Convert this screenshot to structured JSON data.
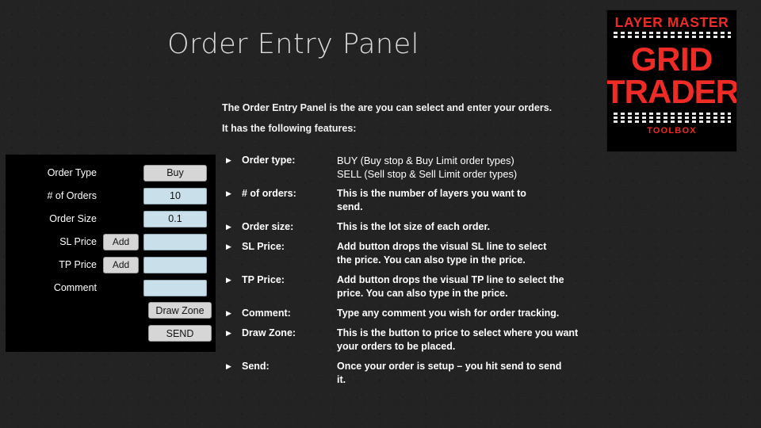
{
  "page": {
    "title": "Order Entry Panel",
    "background_color": "#232323"
  },
  "logo": {
    "top_text": "LAYER MASTER",
    "main_line1": "GRID",
    "main_line2": "TRADER",
    "bottom_text": "TOOLBOX",
    "accent_color": "#ee2b24",
    "background_color": "#000000"
  },
  "intro": {
    "line1": "The Order Entry Panel is the are you can select and enter your orders.",
    "line2": "It has the following features:"
  },
  "order_panel": {
    "rows": [
      {
        "label": "Order Type",
        "add_button": null,
        "value": "Buy",
        "style": "gray"
      },
      {
        "label": "# of Orders",
        "add_button": null,
        "value": "10",
        "style": "blue"
      },
      {
        "label": "Order Size",
        "add_button": null,
        "value": "0.1",
        "style": "blue"
      },
      {
        "label": "SL Price",
        "add_button": "Add",
        "value": "",
        "style": "blue"
      },
      {
        "label": "TP Price",
        "add_button": "Add",
        "value": "",
        "style": "blue"
      },
      {
        "label": "Comment",
        "add_button": null,
        "value": "",
        "style": "blue"
      }
    ],
    "draw_zone_button": "Draw Zone",
    "send_button": "SEND",
    "field_color": "#c9dfe9",
    "button_color": "#d6d6d6"
  },
  "features": {
    "bullet_glyph": "▶",
    "items": [
      {
        "label": "Order type:",
        "desc_lines": [
          "BUY (Buy stop & Buy Limit order types)",
          "SELL (Sell stop & Sell Limit order types)"
        ],
        "weight": "regular"
      },
      {
        "label": "# of orders:",
        "desc_lines": [
          "This is the number of layers you want to",
          "send."
        ],
        "weight": "bold"
      },
      {
        "label": "Order size:",
        "desc_lines": [
          "This is the lot size of each order."
        ],
        "weight": "bold"
      },
      {
        "label": "SL Price:",
        "desc_lines": [
          "Add button drops the visual SL line to select",
          "the price. You can also type in the price."
        ],
        "weight": "bold"
      },
      {
        "label": "TP Price:",
        "desc_lines": [
          "Add button drops the visual TP line to select the",
          "price. You can also type in the price."
        ],
        "weight": "bold"
      },
      {
        "label": "Comment:",
        "desc_lines": [
          "Type any comment you wish for order tracking."
        ],
        "weight": "bold"
      },
      {
        "label": "Draw Zone:",
        "desc_lines": [
          "This is the button to price to select where you want",
          "your orders to be placed."
        ],
        "weight": "bold"
      },
      {
        "label": "Send:",
        "desc_lines": [
          "Once your order is setup – you hit send to send",
          "it."
        ],
        "weight": "bold"
      }
    ]
  }
}
